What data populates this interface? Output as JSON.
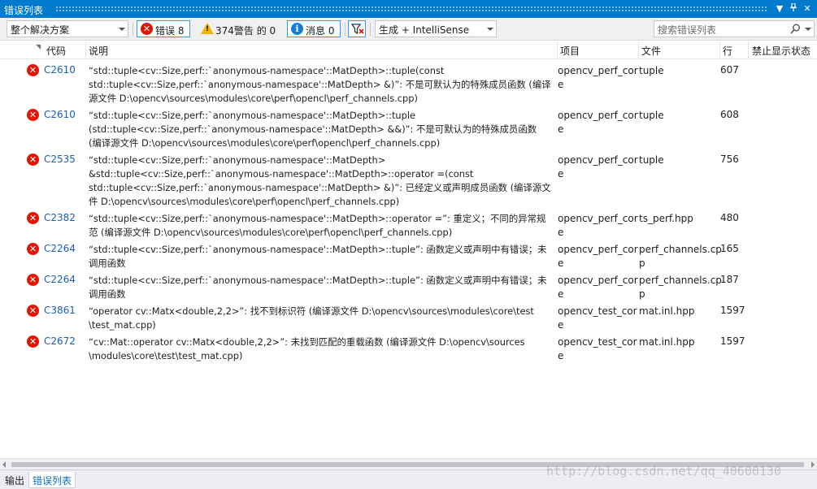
{
  "window": {
    "title": "错误列表"
  },
  "toolbar": {
    "scope": "整个解决方案",
    "errors_label": "错误 8",
    "warnings_label": "374警告 的 0",
    "messages_label": "消息 0",
    "build_filter": "生成 + IntelliSense",
    "search_placeholder": "搜索错误列表"
  },
  "columns": {
    "code": "代码",
    "description": "说明",
    "project": "项目",
    "file": "文件",
    "line": "行",
    "suppression": "禁止显示状态"
  },
  "errors": [
    {
      "code": "C2610",
      "description": [
        "“std::tuple<cv::Size,perf::`anonymous-namespace'::MatDepth>::tuple(const",
        "std::tuple<cv::Size,perf::`anonymous-namespace'::MatDepth> &)”: 不是可默认为的特殊成员函数 (编译",
        "源文件 D:\\opencv\\sources\\modules\\core\\perf\\opencl\\perf_channels.cpp)"
      ],
      "project": [
        "opencv_perf_cor",
        "e"
      ],
      "file": [
        "tuple"
      ],
      "line": "607"
    },
    {
      "code": "C2610",
      "description": [
        "“std::tuple<cv::Size,perf::`anonymous-namespace'::MatDepth>::tuple",
        "(std::tuple<cv::Size,perf::`anonymous-namespace'::MatDepth> &&)”: 不是可默认为的特殊成员函数",
        "(编译源文件 D:\\opencv\\sources\\modules\\core\\perf\\opencl\\perf_channels.cpp)"
      ],
      "project": [
        "opencv_perf_cor",
        "e"
      ],
      "file": [
        "tuple"
      ],
      "line": "608"
    },
    {
      "code": "C2535",
      "description": [
        "“std::tuple<cv::Size,perf::`anonymous-namespace'::MatDepth>",
        "&std::tuple<cv::Size,perf::`anonymous-namespace'::MatDepth>::operator =(const",
        "std::tuple<cv::Size,perf::`anonymous-namespace'::MatDepth> &)”: 已经定义或声明成员函数 (编译源文",
        "件 D:\\opencv\\sources\\modules\\core\\perf\\opencl\\perf_channels.cpp)"
      ],
      "project": [
        "opencv_perf_cor",
        "e"
      ],
      "file": [
        "tuple"
      ],
      "line": "756"
    },
    {
      "code": "C2382",
      "description": [
        "“std::tuple<cv::Size,perf::`anonymous-namespace'::MatDepth>::operator =”: 重定义；不同的异常规",
        "范 (编译源文件 D:\\opencv\\sources\\modules\\core\\perf\\opencl\\perf_channels.cpp)"
      ],
      "project": [
        "opencv_perf_cor",
        "e"
      ],
      "file": [
        "ts_perf.hpp"
      ],
      "line": "480"
    },
    {
      "code": "C2264",
      "description": [
        "“std::tuple<cv::Size,perf::`anonymous-namespace'::MatDepth>::tuple”: 函数定义或声明中有错误；未",
        "调用函数"
      ],
      "project": [
        "opencv_perf_cor",
        "e"
      ],
      "file": [
        "perf_channels.cp",
        "p"
      ],
      "line": "165"
    },
    {
      "code": "C2264",
      "description": [
        "“std::tuple<cv::Size,perf::`anonymous-namespace'::MatDepth>::tuple”: 函数定义或声明中有错误；未",
        "调用函数"
      ],
      "project": [
        "opencv_perf_cor",
        "e"
      ],
      "file": [
        "perf_channels.cp",
        "p"
      ],
      "line": "187"
    },
    {
      "code": "C3861",
      "description": [
        "“operator cv::Matx<double,2,2>”: 找不到标识符 (编译源文件 D:\\opencv\\sources\\modules\\core\\test",
        "\\test_mat.cpp)"
      ],
      "project": [
        "opencv_test_cor",
        "e"
      ],
      "file": [
        "mat.inl.hpp"
      ],
      "line": "1597"
    },
    {
      "code": "C2672",
      "description": [
        "“cv::Mat::operator cv::Matx<double,2,2>”: 未找到匹配的重载函数 (编译源文件 D:\\opencv\\sources",
        "\\modules\\core\\test\\test_mat.cpp)"
      ],
      "project": [
        "opencv_test_cor",
        "e"
      ],
      "file": [
        "mat.inl.hpp"
      ],
      "line": "1597"
    }
  ],
  "bottom_tabs": [
    "输出",
    "错误列表"
  ],
  "watermark": "http://blog.csdn.net/qq_40600130"
}
